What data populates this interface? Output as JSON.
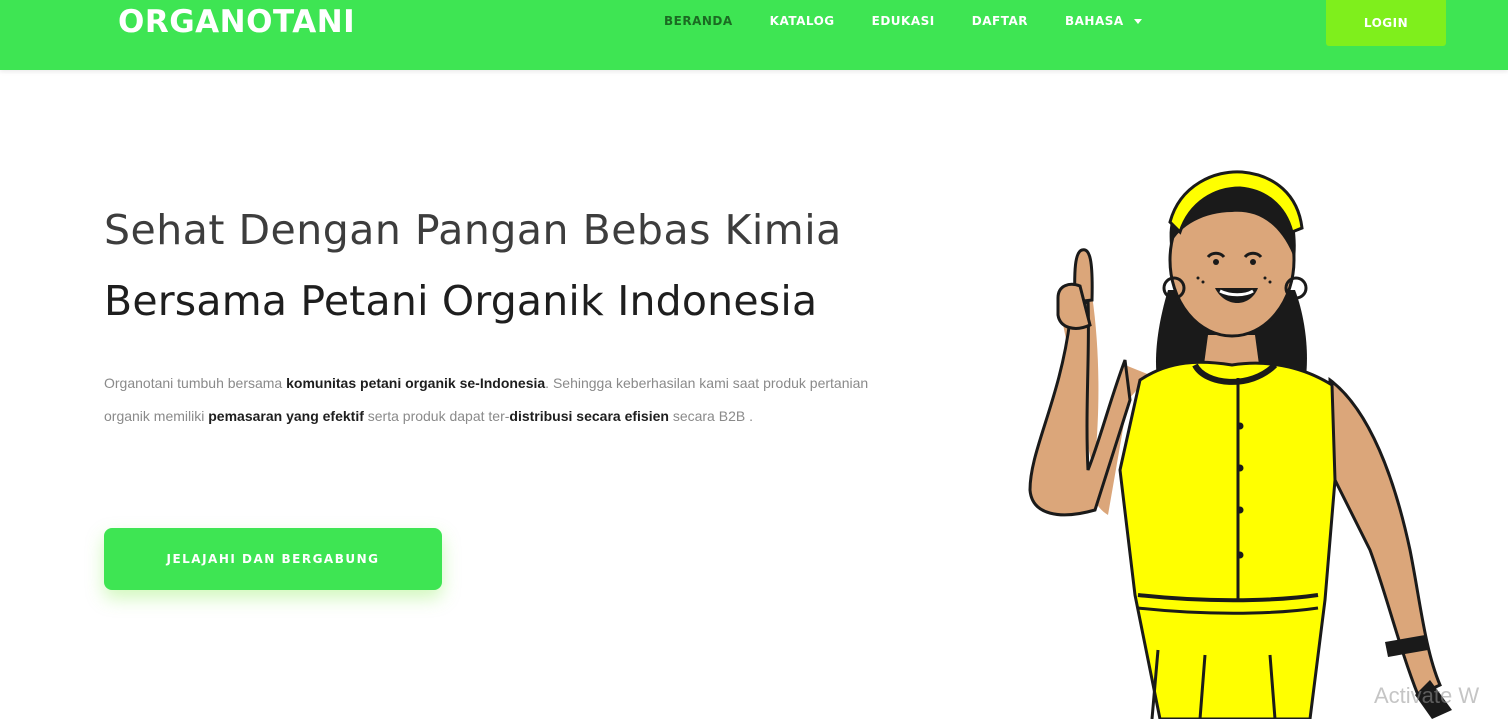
{
  "header": {
    "brand": "ORGANOTANI",
    "nav": [
      {
        "label": "BERANDA"
      },
      {
        "label": "KATALOG"
      },
      {
        "label": "EDUKASI"
      },
      {
        "label": "DAFTAR"
      },
      {
        "label": "BAHASA"
      }
    ],
    "login_label": "LOGIN"
  },
  "hero": {
    "title_line1": "Sehat Dengan Pangan Bebas Kimia",
    "title_line2": "Bersama Petani Organik Indonesia",
    "desc": {
      "p1": "Organotani tumbuh bersama ",
      "b1": "komunitas petani organik se-Indonesia",
      "p2": ". Sehingga keberhasilan kami saat produk pertanian organik memiliki ",
      "b2": "pemasaran yang efektif",
      "p3": " serta produk dapat ter-",
      "b3": "distribusi secara efisien",
      "p4": " secara B2B ."
    },
    "cta_label": "JELAJAHI DAN BERGABUNG"
  },
  "watermark": "Activate W",
  "colors": {
    "primary_green": "#3ee553",
    "login_green": "#7fef1c",
    "active_nav": "#1b6b22",
    "dress_yellow": "#ffff00",
    "skin": "#dba67a"
  },
  "icons": {
    "dropdown": "chevron-down-icon",
    "illustration": "woman-pointing-up"
  }
}
